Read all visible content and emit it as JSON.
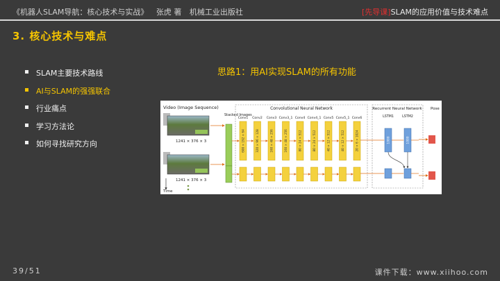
{
  "header": {
    "book_title": "《机器人SLAM导航：核心技术与实战》",
    "author": "张虎 著",
    "publisher": "机械工业出版社",
    "tag": "[先导课]",
    "course_title": "SLAM的应用价值与技术难点"
  },
  "section_title": "3. 核心技术与难点",
  "bullets": [
    {
      "label": "SLAM主要技术路线",
      "active": false
    },
    {
      "label": "AI与SLAM的强强联合",
      "active": true
    },
    {
      "label": "行业痛点",
      "active": false
    },
    {
      "label": "学习方法论",
      "active": false
    },
    {
      "label": "如何寻找研究方向",
      "active": false
    }
  ],
  "idea_title": "思路1：用AI实现SLAM的所有功能",
  "figure": {
    "video_label": "Video (Image Sequence)",
    "resolution": "1241 × 376 × 3",
    "time_label": "Time",
    "stacked_label": "Stacked Images",
    "cnn_label": "Convolutional Neural Network",
    "rnn_label": "Recurrent Neural Network",
    "pose_label": "Pose",
    "layers": [
      {
        "name": "Conv1",
        "dims": "600 × 192 × 64"
      },
      {
        "name": "Conv2",
        "dims": "320 × 96 × 128"
      },
      {
        "name": "Conv3",
        "dims": "160 × 48 × 256"
      },
      {
        "name": "Conv3_1",
        "dims": "160 × 48 × 256"
      },
      {
        "name": "Conv4",
        "dims": "80 × 24 × 512"
      },
      {
        "name": "Conv4_1",
        "dims": "80 × 24 × 512"
      },
      {
        "name": "Conv5",
        "dims": "40 × 12 × 512"
      },
      {
        "name": "Conv5_1",
        "dims": "40 × 12 × 512"
      },
      {
        "name": "Conv6",
        "dims": "20 × 6 × 1024"
      }
    ],
    "lstm": [
      {
        "name": "LSTM1",
        "units": "1000"
      },
      {
        "name": "LSTM2",
        "units": "1000"
      }
    ],
    "colors": {
      "conv": "#f4d13d",
      "conv_border": "#c9a300",
      "stack": "#9acd5a",
      "lstm": "#6fa0dc",
      "pose": "#e2564b",
      "arrow": "#e0711c"
    }
  },
  "footer": {
    "page": "39/51",
    "download": "课件下载：www.xiihoo.com"
  }
}
